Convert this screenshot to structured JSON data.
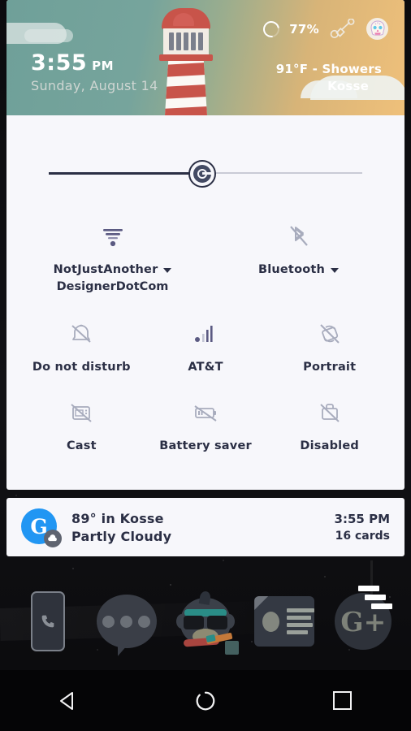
{
  "header": {
    "clock_time": "3:55",
    "clock_ampm": "PM",
    "date": "Sunday, August 14",
    "weather_condition": "91°F - Showers",
    "weather_city": "Kosse",
    "battery_percent": "77%",
    "battery_icon": "battery-ring-icon",
    "edit_icon": "edit-tiles-icon",
    "avatar_icon": "sugar-skull-avatar",
    "lighthouse_icon": "lighthouse-illustration"
  },
  "brightness": {
    "name": "brightness-slider",
    "value": "50"
  },
  "tiles": {
    "row1": [
      {
        "label": "NotJustAnother",
        "sublabel": "DesignerDotCom",
        "icon": "wifi-icon",
        "state": "on",
        "expandable": true
      },
      {
        "label": "Bluetooth",
        "sublabel": "",
        "icon": "bluetooth-off-icon",
        "state": "off",
        "expandable": true
      }
    ],
    "row2": [
      {
        "label": "Do not disturb",
        "icon": "do-not-disturb-off-icon",
        "state": "off"
      },
      {
        "label": "AT&T",
        "icon": "cell-signal-icon",
        "state": "on"
      },
      {
        "label": "Portrait",
        "icon": "rotation-lock-icon",
        "state": "off"
      }
    ],
    "row3": [
      {
        "label": "Cast",
        "icon": "cast-off-icon",
        "state": "off"
      },
      {
        "label": "Battery saver",
        "icon": "battery-saver-off-icon",
        "state": "off"
      },
      {
        "label": "Disabled",
        "icon": "work-profile-off-icon",
        "state": "off"
      }
    ]
  },
  "now_card": {
    "icon": "google-logo-icon",
    "badge_icon": "cloud-icon",
    "line1": "89° in Kosse",
    "line2": "Partly Cloudy",
    "time": "3:55 PM",
    "cards_count": "16 cards"
  },
  "dock": [
    {
      "name": "phone-app",
      "icon": "phone-icon"
    },
    {
      "name": "messaging-app",
      "icon": "sms-bubble-icon"
    },
    {
      "name": "mascot-app",
      "icon": "gorilla-mascot-icon"
    },
    {
      "name": "news-app",
      "icon": "news-document-icon"
    },
    {
      "name": "google-plus-app",
      "icon": "google-plus-icon"
    }
  ],
  "navbar": [
    {
      "name": "back-button",
      "icon": "back-triangle-icon"
    },
    {
      "name": "home-button",
      "icon": "home-circle-icon"
    },
    {
      "name": "recents-button",
      "icon": "recents-square-icon"
    }
  ],
  "colors": {
    "panel_bg": "#f7f7fb",
    "text_dark": "#2b2f45",
    "icon_active": "#5b5a82",
    "icon_inactive": "#a8acbd",
    "google_blue": "#2196f3",
    "lighthouse_red": "#c8544a"
  }
}
